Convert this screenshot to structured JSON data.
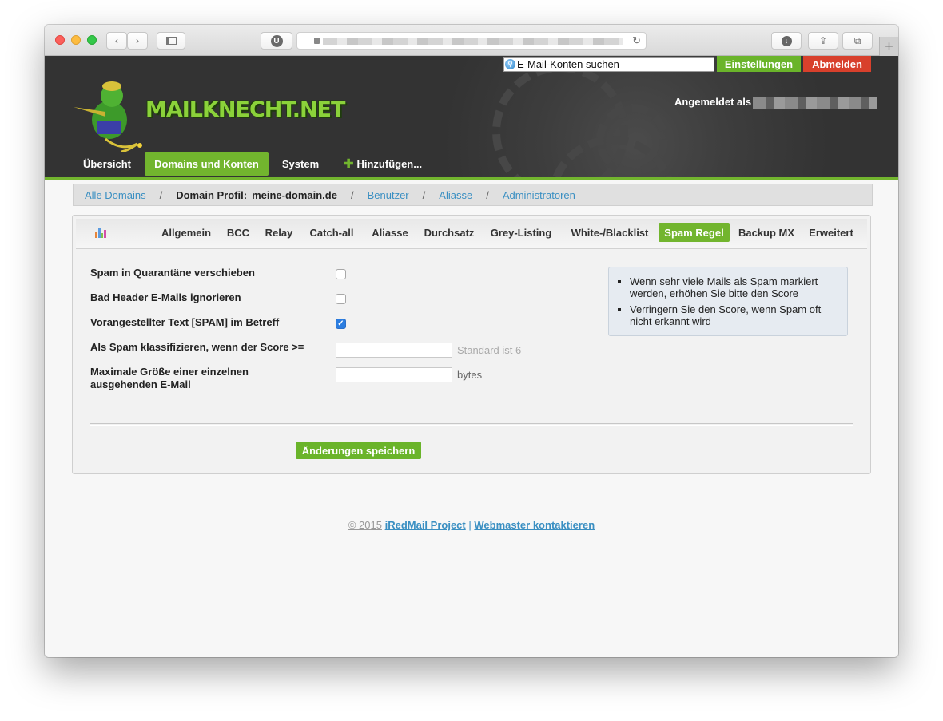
{
  "header": {
    "search_placeholder": "E-Mail-Konten suchen",
    "settings_label": "Einstellungen",
    "logout_label": "Abmelden",
    "logo_text": "MAILKNECHT.NET",
    "logged_in_label": "Angemeldet als"
  },
  "nav": {
    "items": [
      {
        "label": "Übersicht"
      },
      {
        "label": "Domains und Konten"
      },
      {
        "label": "System"
      },
      {
        "label": "Hinzufügen..."
      }
    ]
  },
  "breadcrumb": {
    "all_domains": "Alle Domains",
    "domain_profile_label": "Domain Profil:",
    "domain_name": "meine-domain.de",
    "users": "Benutzer",
    "aliases": "Aliasse",
    "admins": "Administratoren"
  },
  "tabs": [
    {
      "label": "Allgemein"
    },
    {
      "label": "BCC"
    },
    {
      "label": "Relay"
    },
    {
      "label": "Catch-all"
    },
    {
      "label": "Aliasse"
    },
    {
      "label": "Durchsatz"
    },
    {
      "label": "Grey-Listing"
    },
    {
      "label": "White-/Blacklist"
    },
    {
      "label": "Spam Regel"
    },
    {
      "label": "Backup MX"
    },
    {
      "label": "Erweitert"
    }
  ],
  "form": {
    "quarantine_label": "Spam in Quarantäne verschieben",
    "quarantine_checked": false,
    "bad_header_label": "Bad Header E-Mails ignorieren",
    "bad_header_checked": false,
    "prefix_label": "Vorangestellter Text [SPAM] im Betreff",
    "prefix_checked": true,
    "score_label": "Als Spam klassifizieren, wenn der Score >=",
    "score_value": "",
    "score_hint": "Standard ist 6",
    "max_size_label_1": "Maximale Größe einer einzelnen",
    "max_size_label_2": "ausgehenden E-Mail",
    "max_size_value": "",
    "max_size_unit": "bytes",
    "save_label": "Änderungen speichern"
  },
  "info": {
    "items": [
      "Wenn sehr viele Mails als Spam markiert werden, erhöhen Sie bitte den Score",
      "Verringern Sie den Score, wenn Spam oft nicht erkannt wird"
    ]
  },
  "footer": {
    "copyright": "© 2015",
    "project": "iRedMail Project",
    "separator": "|",
    "contact": "Webmaster kontaktieren"
  },
  "colors": {
    "accent": "#72b52e",
    "danger": "#d8402c",
    "link": "#3a8fc2"
  }
}
